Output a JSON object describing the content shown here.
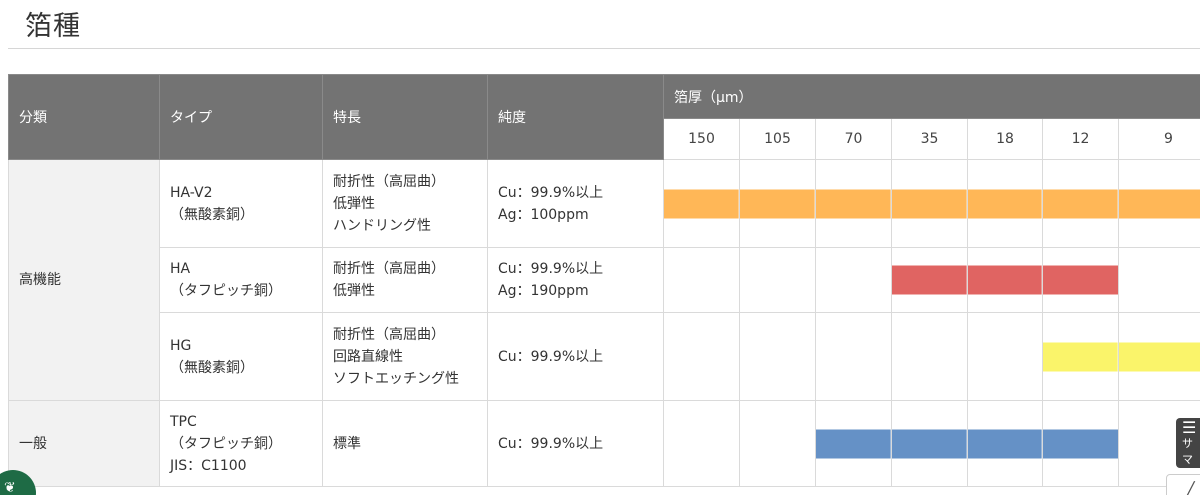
{
  "page": {
    "title": "箔種"
  },
  "table": {
    "headers": {
      "category": "分類",
      "type": "タイプ",
      "feature": "特長",
      "purity": "純度",
      "thickness": "箔厚（μm）"
    },
    "thickness_values": [
      "150",
      "105",
      "70",
      "35",
      "18",
      "12",
      "9"
    ],
    "groups": [
      {
        "category": "高機能"
      },
      {
        "category": "一般"
      }
    ],
    "rows": [
      {
        "type": [
          "HA-V2",
          "（無酸素銅）"
        ],
        "feature": [
          "耐折性（高屈曲）",
          "低弾性",
          "ハンドリング性"
        ],
        "purity": [
          "Cu：99.9%以上",
          "Ag：100ppm"
        ],
        "range": [
          "150",
          "9"
        ],
        "color": "#ffb757"
      },
      {
        "type": [
          "HA",
          "（タフピッチ銅）"
        ],
        "feature": [
          "耐折性（高屈曲）",
          "低弾性"
        ],
        "purity": [
          "Cu：99.9%以上",
          "Ag：190ppm"
        ],
        "range": [
          "35",
          "12"
        ],
        "color": "#e06462"
      },
      {
        "type": [
          "HG",
          "（無酸素銅）"
        ],
        "feature": [
          "耐折性（高屈曲）",
          "回路直線性",
          "ソフトエッチング性"
        ],
        "purity": [
          "Cu：99.9%以上"
        ],
        "range": [
          "12",
          "9"
        ],
        "color": "#faf46a"
      },
      {
        "type": [
          "TPC",
          "（タフピッチ銅）",
          "JIS：C1100"
        ],
        "feature": [
          "標準"
        ],
        "purity": [
          "Cu：99.9%以上"
        ],
        "range": [
          "70",
          "12"
        ],
        "color": "#6591c6"
      }
    ]
  },
  "side_tab": {
    "icon": "menu-lines-icon",
    "label": "サ\nマ"
  },
  "side_button": {
    "icon": "chevron-icon"
  },
  "float_button": {
    "icon": "leaf-icon"
  }
}
